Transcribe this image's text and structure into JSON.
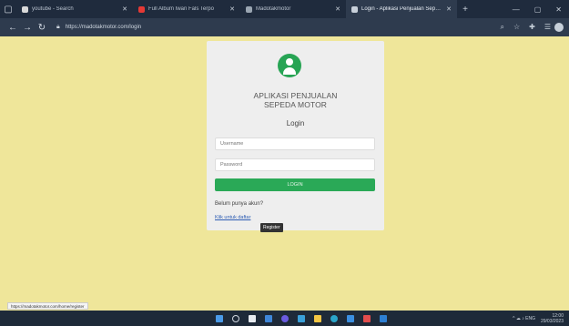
{
  "browser": {
    "tabs": [
      {
        "title": "youtube - Search",
        "fav_color": "#d9d9d9",
        "active": false
      },
      {
        "title": "Full Album Iwan Fals Terpo",
        "fav_color": "#e53935",
        "active": false
      },
      {
        "title": "Madotakmotor",
        "fav_color": "#9aa6b2",
        "active": false
      },
      {
        "title": "Login - Aplikasi Penjualan Seped",
        "fav_color": "#c8d0da",
        "active": true
      }
    ],
    "new_tab_label": "+",
    "url": "https://madotakmotor.com/login",
    "icons": {
      "menu": "browser-menu-icon",
      "back": "back-arrow-icon",
      "forward": "forward-arrow-icon",
      "reload": "reload-icon",
      "lock": "lock-icon"
    }
  },
  "login": {
    "app_title_line1": "APLIKASI PENJUALAN",
    "app_title_line2": "SEPEDA MOTOR",
    "heading": "Login",
    "username_placeholder": "Username",
    "password_placeholder": "Password",
    "submit_label": "LOGIN",
    "no_account_text": "Belum punya akun?",
    "register_link_text": "Klik untuk daftar",
    "tooltip": "Register",
    "avatar_color": "#27a454",
    "button_color": "#2aa957",
    "card_color": "#eeeeee",
    "page_bg": "#efe69a"
  },
  "status_bar_url": "https://madotakmotor.com/home/register",
  "taskbar": {
    "time": "12:00",
    "date": "29/03/2023",
    "tray_text": "^ ☁ ♪ ENG"
  }
}
